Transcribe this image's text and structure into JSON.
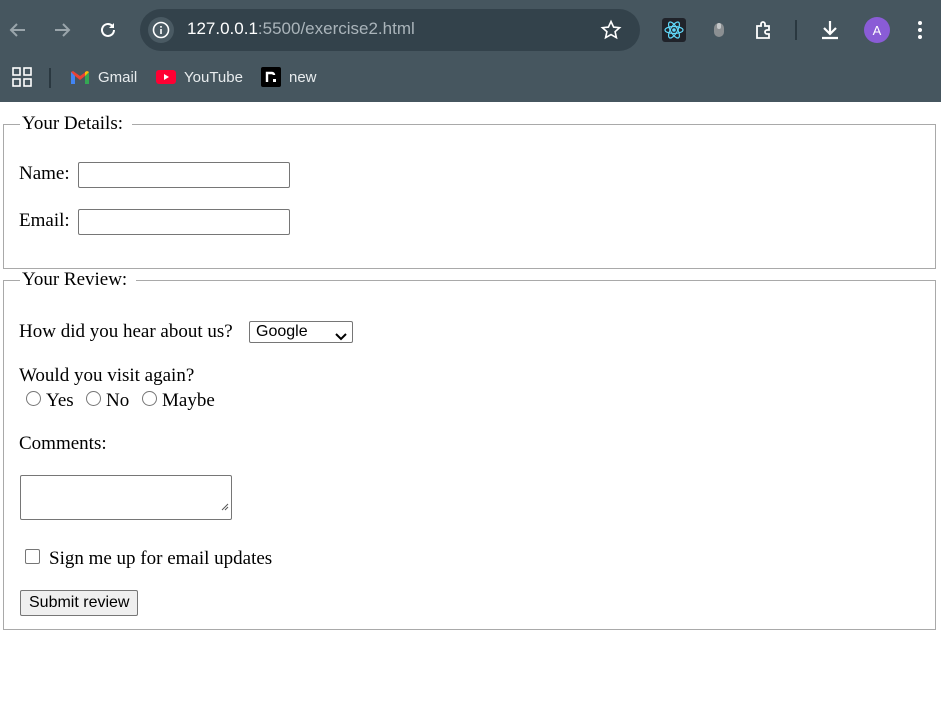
{
  "browser": {
    "url_host": "127.0.0.1",
    "url_rest": ":5500/exercise2.html",
    "avatar_letter": "A",
    "bookmarks": [
      {
        "label": "Gmail",
        "icon": "gmail-icon"
      },
      {
        "label": "YouTube",
        "icon": "youtube-icon"
      },
      {
        "label": "new",
        "icon": "r-icon"
      }
    ]
  },
  "details": {
    "legend": "Your Details:",
    "name_label": "Name:",
    "name_value": "",
    "email_label": "Email:",
    "email_value": ""
  },
  "review": {
    "legend": "Your Review:",
    "hear_label": "How did you hear about us?",
    "hear_selected": "Google",
    "visit_label": "Would you visit again?",
    "visit_options": [
      "Yes",
      "No",
      "Maybe"
    ],
    "comments_label": "Comments:",
    "comments_value": "",
    "signup_label": "Sign me up for email updates",
    "submit_label": "Submit review"
  },
  "colors": {
    "chrome_bg": "#46565f",
    "omnibox_bg": "#33424b",
    "avatar_bg": "#8a5cd6"
  }
}
